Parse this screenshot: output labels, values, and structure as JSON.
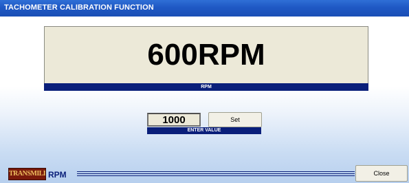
{
  "window": {
    "title": "TACHOMETER CALIBRATION FUNCTION"
  },
  "display": {
    "reading": "600RPM",
    "unit_label": "RPM"
  },
  "input": {
    "value": "1000",
    "caption": "ENTER VALUE"
  },
  "buttons": {
    "set_label": "Set",
    "close_label": "Close"
  },
  "footer": {
    "logo_text": "TRANSMILLE",
    "mode_label": "RPM"
  },
  "colors": {
    "title_bar": "#1f58c4",
    "label_bar": "#0a1f7a",
    "display_bg": "#ece9d8"
  }
}
